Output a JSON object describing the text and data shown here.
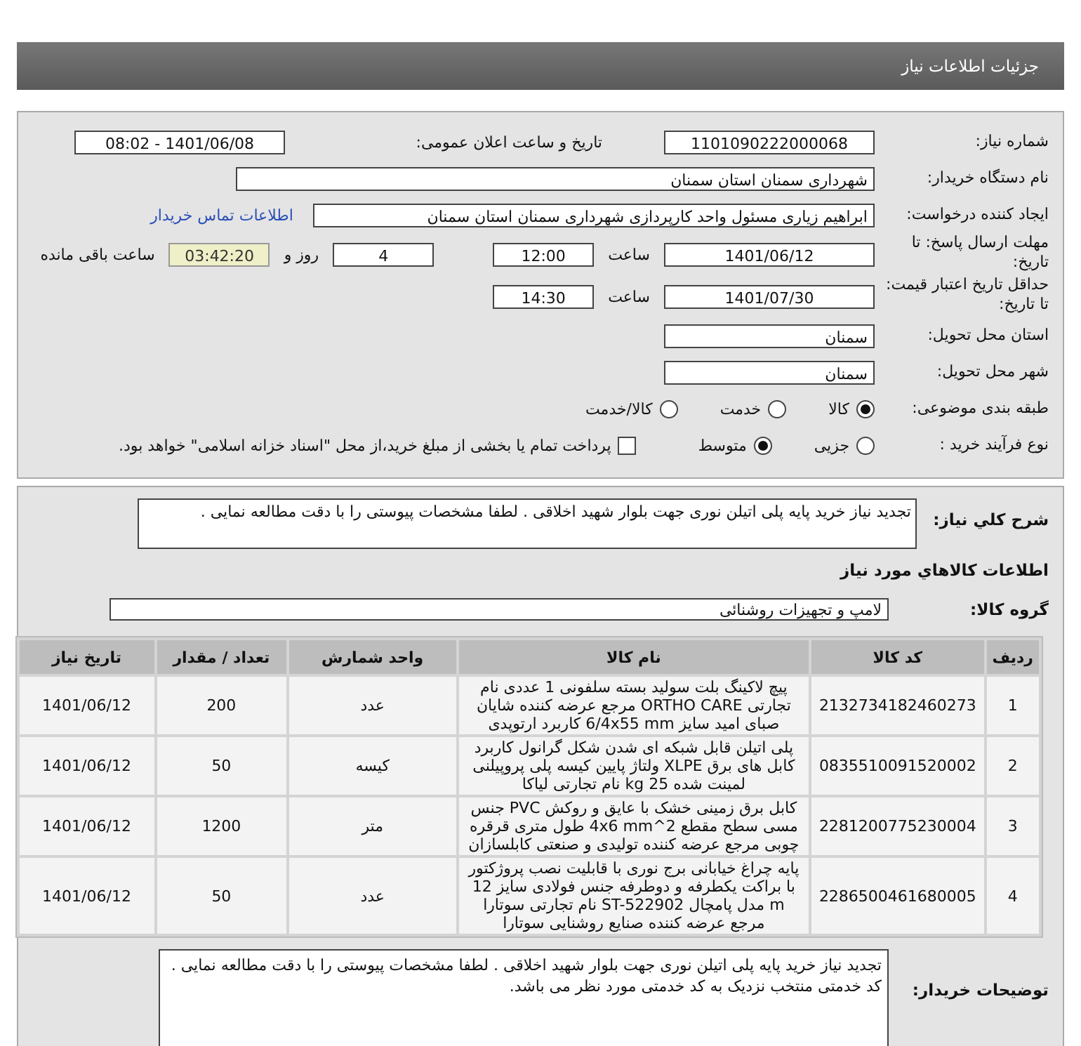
{
  "header": {
    "title": "جزئیات اطلاعات نیاز"
  },
  "need_number": {
    "label": "شماره نیاز:",
    "value": "1101090222000068"
  },
  "announce": {
    "label": "تاریخ و ساعت اعلان عمومی:",
    "value": "1401/06/08 - 08:02"
  },
  "buyer": {
    "label": "نام دستگاه خریدار:",
    "value": "شهرداری سمنان استان سمنان"
  },
  "requester": {
    "label": "ایجاد کننده درخواست:",
    "value": "ابراهیم زیاری مسئول واحد کارپردازی شهرداری سمنان استان سمنان",
    "link": "اطلاعات تماس خریدار"
  },
  "deadline": {
    "label": "مهلت ارسال پاسخ: تا تاریخ:",
    "date": "1401/06/12",
    "time_label": "ساعت",
    "time": "12:00",
    "days": "4",
    "days_label": "روز و",
    "remaining": "03:42:20",
    "remaining_label": "ساعت باقی مانده"
  },
  "validity": {
    "label": "حداقل تاریخ اعتبار قیمت: تا تاریخ:",
    "date": "1401/07/30",
    "time_label": "ساعت",
    "time": "14:30"
  },
  "province": {
    "label": "استان محل تحویل:",
    "value": "سمنان"
  },
  "city": {
    "label": "شهر محل تحویل:",
    "value": "سمنان"
  },
  "category": {
    "label": "طبقه بندی موضوعی:",
    "options": [
      {
        "label": "کالا",
        "selected": true
      },
      {
        "label": "خدمت",
        "selected": false
      },
      {
        "label": "کالا/خدمت",
        "selected": false
      }
    ]
  },
  "process": {
    "label": "نوع فرآیند خرید :",
    "options": [
      {
        "label": "جزیی",
        "selected": false
      },
      {
        "label": "متوسط",
        "selected": true
      }
    ],
    "payment": {
      "label": "پرداخت تمام یا بخشی از مبلغ خرید،از محل \"اسناد خزانه اسلامی\" خواهد بود.",
      "checked": false
    }
  },
  "summary": {
    "label": "شرح کلي نياز:",
    "value": "تجدید نیاز خرید پایه پلی اتیلن نوری جهت بلوار شهید اخلاقی . لطفا مشخصات پیوستی را با دقت مطالعه نمایی ."
  },
  "goods_title": "اطلاعات كالاهاي مورد نياز",
  "group": {
    "label": "گروه كالا:",
    "value": "لامپ و تجهیزات روشنائی"
  },
  "table": {
    "columns": [
      "ردیف",
      "کد کالا",
      "نام کالا",
      "واحد شمارش",
      "تعداد / مقدار",
      "تاریخ نیاز"
    ],
    "rows": [
      [
        "1",
        "2132734182460273",
        "پیچ لاکینگ بلت سولید بسته سلفونی 1 عددی نام تجارتی ORTHO CARE مرجع عرضه کننده شایان صبای امید سایز 6/4x55 mm کاربرد ارتوپدی",
        "عدد",
        "200",
        "1401/06/12"
      ],
      [
        "2",
        "0835510091520002",
        "پلی اتیلن قابل شبکه ای شدن شکل گرانول کاربرد کابل های برق XLPE ولتاژ پایین کیسه پلی پروپیلنی لمینت شده 25 kg نام تجارتی لیاکا",
        "کیسه",
        "50",
        "1401/06/12"
      ],
      [
        "3",
        "2281200775230004",
        "کابل برق زمینی خشک با عایق و روکش PVC جنس مسی سطح مقطع 4x6 mm^2 طول متری قرقره چوبی مرجع عرضه کننده تولیدی و صنعتی کابلسازان",
        "متر",
        "1200",
        "1401/06/12"
      ],
      [
        "4",
        "2286500461680005",
        "پایه چراغ خیابانی برج نوری با قابلیت نصب پروژکتور با براکت یکطرفه و دوطرفه جنس فولادی سایز 12 m مدل پامچال ST-522902 نام تجارتی سوتارا مرجع عرضه کننده صنایع روشنایی سوتارا",
        "عدد",
        "50",
        "1401/06/12"
      ]
    ]
  },
  "notes": {
    "label": "توضیحات خریدار:",
    "value": "تجدید نیاز خرید پایه پلی اتیلن نوری جهت بلوار شهید اخلاقی . لطفا مشخصات پیوستی را با دقت مطالعه نمایی . کد خدمتی منتخب نزدیک به کد خدمتی مورد نظر می باشد."
  }
}
